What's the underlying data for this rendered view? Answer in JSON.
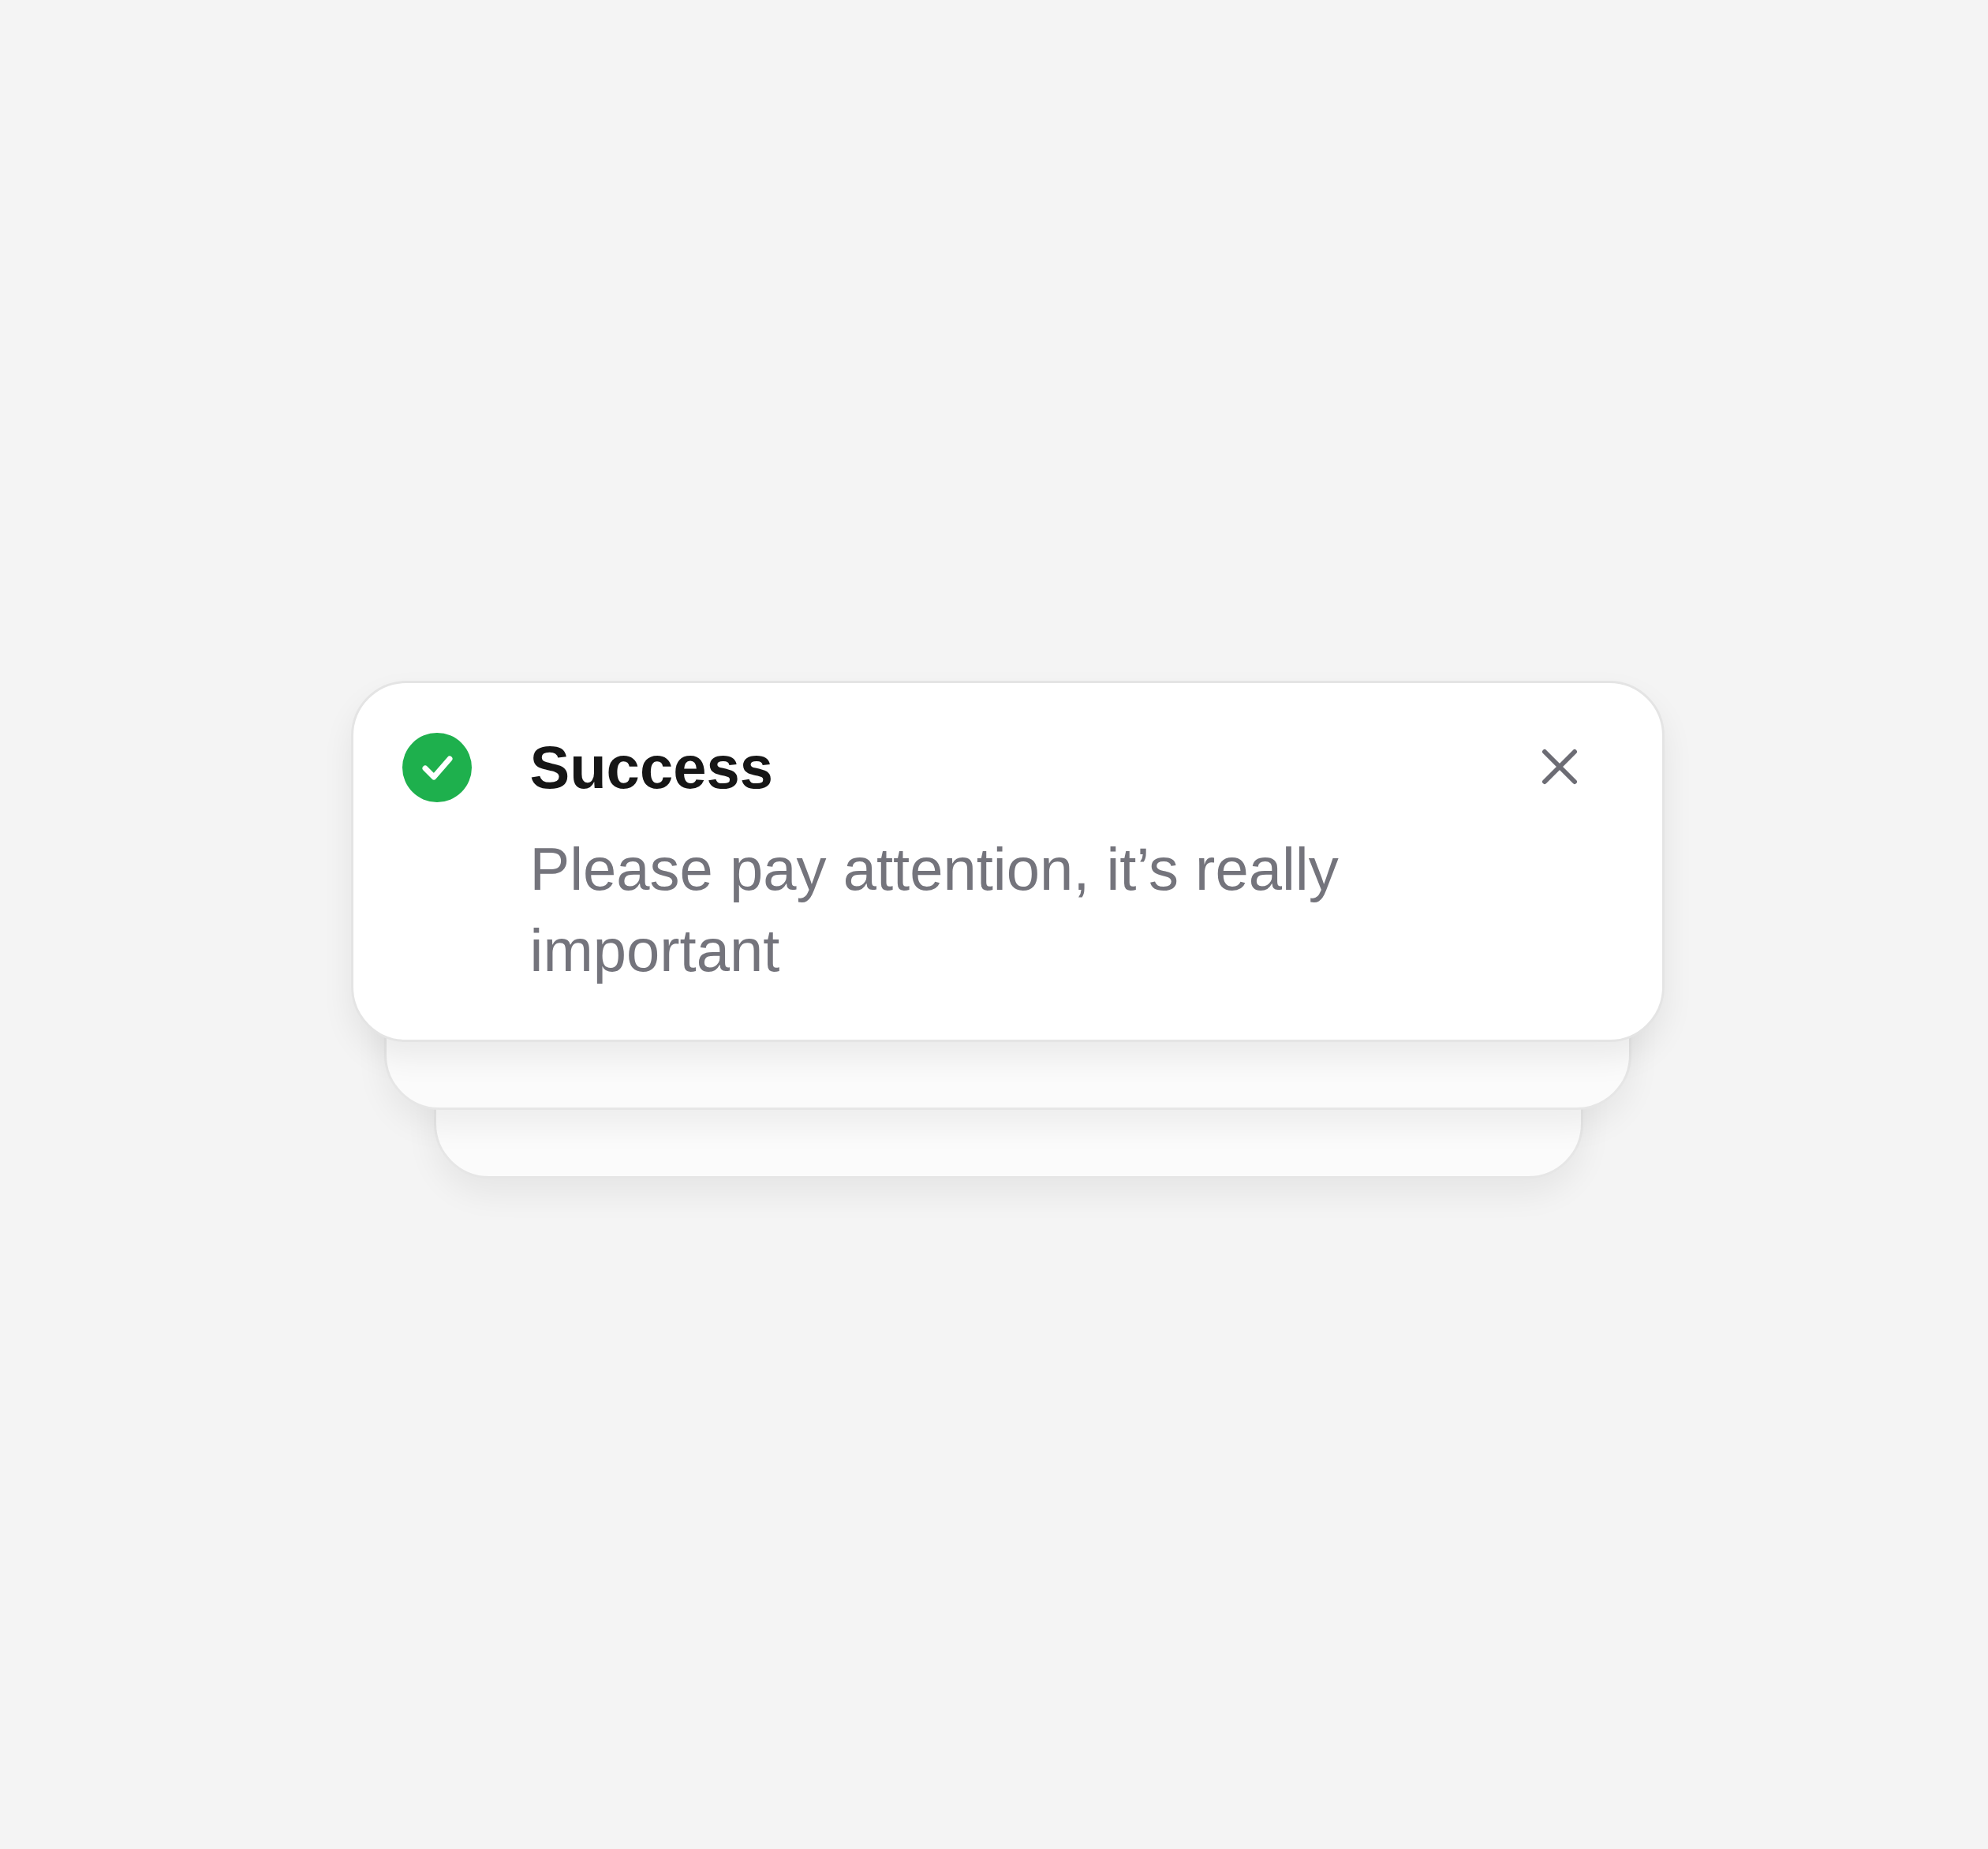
{
  "toast": {
    "title": "Success",
    "message": "Please pay attention, it’s really important"
  },
  "stacked_toasts": [
    {
      "kind": "card"
    },
    {
      "kind": "card"
    }
  ]
}
